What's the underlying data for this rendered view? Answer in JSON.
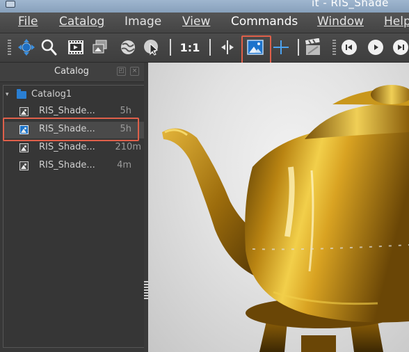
{
  "window": {
    "title": "it - RIS_Shade"
  },
  "menu": {
    "items": [
      {
        "name": "file",
        "label": "File"
      },
      {
        "name": "catalog",
        "label": "Catalog"
      },
      {
        "name": "image",
        "label": "Image"
      },
      {
        "name": "view",
        "label": "View"
      },
      {
        "name": "commands",
        "label": "Commands"
      },
      {
        "name": "window",
        "label": "Window"
      },
      {
        "name": "help",
        "label": "Help"
      }
    ]
  },
  "toolbar": {
    "zoom_label": "1:1",
    "icons": [
      "move-icon",
      "magnifier-icon",
      "filmstrip-icon",
      "image-stack-icon",
      "globe-icon",
      "pointer-globe-icon",
      "one-to-one-icon",
      "split-compare-icon",
      "image-view-icon",
      "crosshair-icon",
      "clapperboard-icon",
      "skip-back-icon",
      "play-icon",
      "skip-forward-icon"
    ],
    "highlighted": "image-view-icon"
  },
  "catalog": {
    "title": "Catalog",
    "root": {
      "label": "Catalog1",
      "expanded": true
    },
    "items": [
      {
        "label": "RIS_Shade...",
        "age": "5h",
        "selected": false
      },
      {
        "label": "RIS_Shade...",
        "age": "5h",
        "selected": true
      },
      {
        "label": "RIS_Shade...",
        "age": "210m",
        "selected": false
      },
      {
        "label": "RIS_Shade...",
        "age": "4m",
        "selected": false
      }
    ]
  },
  "viewport": {
    "content": "rendered-teapot"
  },
  "colors": {
    "accent": "#2a7fd3",
    "highlight": "#e0604a",
    "panel": "#383838",
    "teapot_gold": "#c8920f"
  }
}
